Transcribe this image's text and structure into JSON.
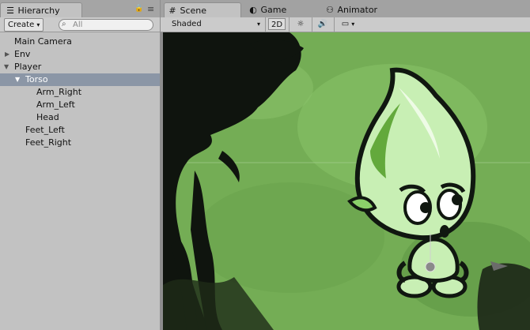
{
  "hierarchy": {
    "tab_label": "Hierarchy",
    "tab_icon": "hierarchy-icon",
    "create_label": "Create",
    "search_placeholder": "All",
    "items": [
      {
        "label": "Main Camera"
      },
      {
        "label": "Env"
      },
      {
        "label": "Player"
      },
      {
        "label": "Torso"
      },
      {
        "label": "Arm_Right"
      },
      {
        "label": "Arm_Left"
      },
      {
        "label": "Head"
      },
      {
        "label": "Feet_Left"
      },
      {
        "label": "Feet_Right"
      }
    ],
    "selected_item": "Torso"
  },
  "tabs": {
    "scene": "Scene",
    "game": "Game",
    "animator": "Animator"
  },
  "scene_toolbar": {
    "draw_mode": "Shaded",
    "mode_2d": "2D",
    "lighting_icon": "sun-icon",
    "audio_icon": "speaker-icon",
    "effects_icon": "image-icon"
  },
  "colors": {
    "selection": "#8b96a6",
    "scene_background": "#74ad55",
    "character_body": "#c8efb4",
    "outline": "#101710"
  }
}
